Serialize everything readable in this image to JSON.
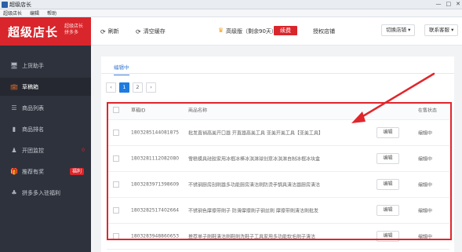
{
  "window": {
    "title": "超级店长",
    "controls": [
      "—",
      "□",
      "✕"
    ]
  },
  "menubar": [
    "超级店长",
    "编辑",
    "帮助"
  ],
  "logo": {
    "main": "超级店长",
    "sub_line1": "超级店长",
    "sub_line2": "拼多多"
  },
  "sidebar": {
    "items": [
      {
        "icon": "monitor-icon",
        "glyph": "🖥",
        "label": "上货助手"
      },
      {
        "icon": "briefcase-icon",
        "glyph": "💼",
        "label": "草稿箱",
        "active": true
      },
      {
        "icon": "list-icon",
        "glyph": "☰",
        "label": "商品列表"
      },
      {
        "icon": "bar-chart-icon",
        "glyph": "▮",
        "label": "商品排名"
      },
      {
        "icon": "person-icon",
        "glyph": "♟",
        "label": "开团监控",
        "dot": "0"
      },
      {
        "icon": "gift-icon",
        "glyph": "🎁",
        "label": "推荐有奖",
        "badge": "福利"
      },
      {
        "icon": "people-icon",
        "glyph": "♣",
        "label": "拼多多入驻福利"
      }
    ]
  },
  "topbar": {
    "refresh": "刷新",
    "clear_cache": "清空缓存",
    "vip_text": "高级版（剩余90天）",
    "renew": "续费",
    "batch": "授权店铺",
    "switch_shop": "切换店铺 ▾",
    "contact": "联系客服 ▾"
  },
  "main": {
    "tab": "编辑中",
    "pager": [
      "‹",
      "1",
      "2",
      "›"
    ],
    "current_page": "1",
    "columns": {
      "id": "草稿ID",
      "name": "商品名称",
      "status": "在售状态"
    },
    "rows": [
      {
        "id": "1803285144081875",
        "name": "批发直销高美开口器 开直器高美工具 亚美开美工具【亚美工具】",
        "action": "编辑",
        "status": "编辑中"
      },
      {
        "id": "1803281112082080",
        "name": "雪糕模具硅胶家用冰棍冰棒冰淇淋球创意冰淇淋自制冰棍冰块盒",
        "action": "编辑",
        "status": "编辑中"
      },
      {
        "id": "1803283971398609",
        "name": "不锈钢厨房刮刷器多功能厨房清洁刷防烫手锅具清洁器厨房清洁",
        "action": "编辑",
        "status": "编辑中"
      },
      {
        "id": "1803282517402664",
        "name": "不锈钢色摩擦带刷子 防滑摩擦刷子钢丝刷 摩擦带刷清洁刷批发",
        "action": "编辑",
        "status": "编辑中"
      },
      {
        "id": "1803283948860653",
        "name": "推荐单子刷鞋清洁刷鞋刷洗鞋子工具家用多功能软毛刷子清洁",
        "action": "编辑",
        "status": "编辑中"
      }
    ]
  },
  "colors": {
    "brand_red": "#d8262c",
    "sidebar_bg": "#2e323c",
    "accent_blue": "#1e7be0"
  }
}
